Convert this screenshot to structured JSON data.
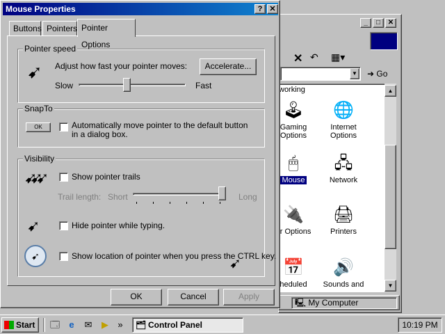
{
  "dialog": {
    "title": "Mouse Properties",
    "help_btn": "?",
    "close_btn": "✕",
    "tabs": [
      "Buttons",
      "Pointers",
      "Pointer Options"
    ],
    "active_tab": "Pointer Options",
    "speed": {
      "legend": "Pointer speed",
      "text": "Adjust how fast your pointer moves:",
      "accelerate": "Accelerate...",
      "slow": "Slow",
      "fast": "Fast",
      "level": 0.45
    },
    "snapto": {
      "legend": "SnapTo",
      "ok_sample": "OK",
      "text": "Automatically move pointer to the default button in a dialog box.",
      "checked": false
    },
    "visibility": {
      "legend": "Visibility",
      "trails_text": "Show pointer trails",
      "trails_checked": false,
      "trail_length_label": "Trail length:",
      "short": "Short",
      "long": "Long",
      "trail_level": 1.0,
      "hide_text": "Hide pointer while typing.",
      "hide_checked": false,
      "ctrl_text": "Show location of pointer when you press the CTRL key.",
      "ctrl_checked": false
    },
    "buttons": {
      "ok": "OK",
      "cancel": "Cancel",
      "apply": "Apply"
    }
  },
  "control_panel": {
    "go": "Go",
    "status": "My Computer",
    "items": [
      {
        "name": "Networking",
        "icon": "network-icon"
      },
      {
        "name": "Gaming Options",
        "icon": "joystick-icon"
      },
      {
        "name": "Internet Options",
        "icon": "globe-icon"
      },
      {
        "name": "Mouse",
        "icon": "mouse-icon"
      },
      {
        "name": "Network",
        "icon": "network-icon"
      },
      {
        "name": "Power Options",
        "icon": "power-icon"
      },
      {
        "name": "Printers",
        "icon": "printer-icon"
      },
      {
        "name": "Scheduled",
        "icon": "scheduled-tasks-icon"
      },
      {
        "name": "Sounds and Multimedia",
        "icon": "speaker-icon"
      }
    ],
    "item_labels": {
      "networking": "working",
      "gaming": "Gaming\nOptions",
      "internet": "Internet\nOptions",
      "mouse": "Mouse",
      "network": "Network",
      "power": "er Options",
      "printers": "Printers",
      "scheduled": "heduled",
      "sounds": "Sounds and"
    }
  },
  "taskbar": {
    "start": "Start",
    "task": "Control Panel",
    "clock": "10:19 PM",
    "more": "»"
  }
}
